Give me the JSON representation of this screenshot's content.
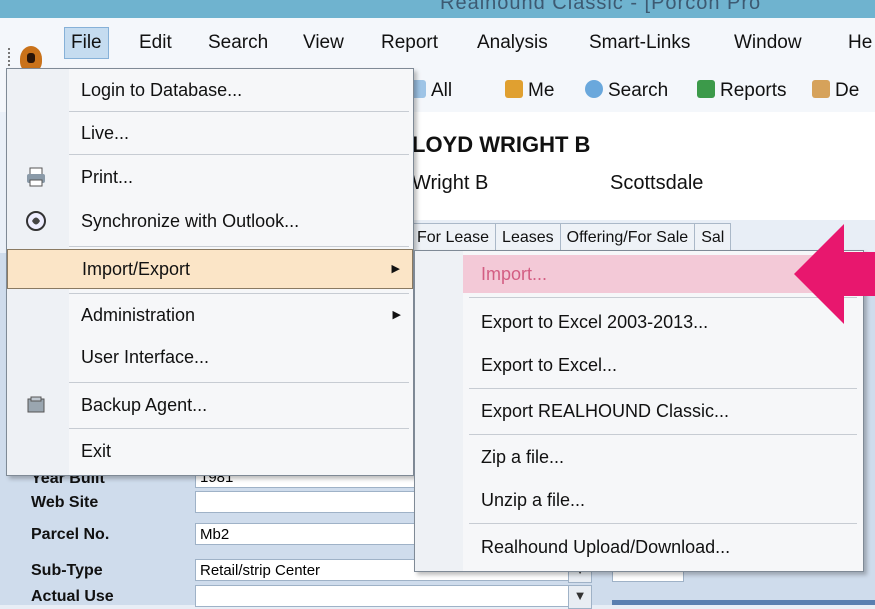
{
  "title_bar": {
    "text": "Realhound Classic - [Porcon Pro"
  },
  "menubar": {
    "items": [
      "File",
      "Edit",
      "Search",
      "View",
      "Report",
      "Analysis",
      "Smart-Links",
      "Window",
      "He"
    ]
  },
  "toolbar": {
    "items": [
      "All",
      "Me",
      "Search",
      "Reports",
      "De"
    ]
  },
  "record": {
    "name": "LOYD WRIGHT B",
    "sub": "Wright B",
    "city": "Scottsdale"
  },
  "tabs": [
    "For Lease",
    "Leases",
    "Offering/For Sale",
    "Sal"
  ],
  "fields": [
    {
      "label": "Year Built",
      "value": "1981"
    },
    {
      "label": "Web Site",
      "value": ""
    },
    {
      "label": "Parcel No.",
      "value": "Mb2"
    },
    {
      "label": "Sub-Type",
      "value": "Retail/strip Center"
    },
    {
      "label": "Actual Use",
      "value": ""
    }
  ],
  "file_menu": {
    "items": [
      {
        "label": "Login to Database...",
        "icon": "none"
      },
      {
        "label": "Live...",
        "icon": "none"
      },
      {
        "label": "Print...",
        "icon": "printer-icon"
      },
      {
        "label": "Synchronize with Outlook...",
        "icon": "outlook-icon"
      },
      {
        "label": "Import/Export",
        "icon": "none"
      },
      {
        "label": "Administration",
        "icon": "none"
      },
      {
        "label": "User Interface...",
        "icon": "none"
      },
      {
        "label": "Backup Agent...",
        "icon": "backup-icon"
      },
      {
        "label": "Exit",
        "icon": "none"
      }
    ]
  },
  "import_export_menu": {
    "items": [
      "Import...",
      "Export to Excel 2003-2013...",
      "Export to Excel...",
      "Export REALHOUND Classic...",
      "Zip a file...",
      "Unzip a file...",
      "Realhound Upload/Download..."
    ]
  },
  "colors": {
    "highlight": "#fbe5c7",
    "import_highlight": "#f3c9d7",
    "arrow": "#e8176e"
  }
}
